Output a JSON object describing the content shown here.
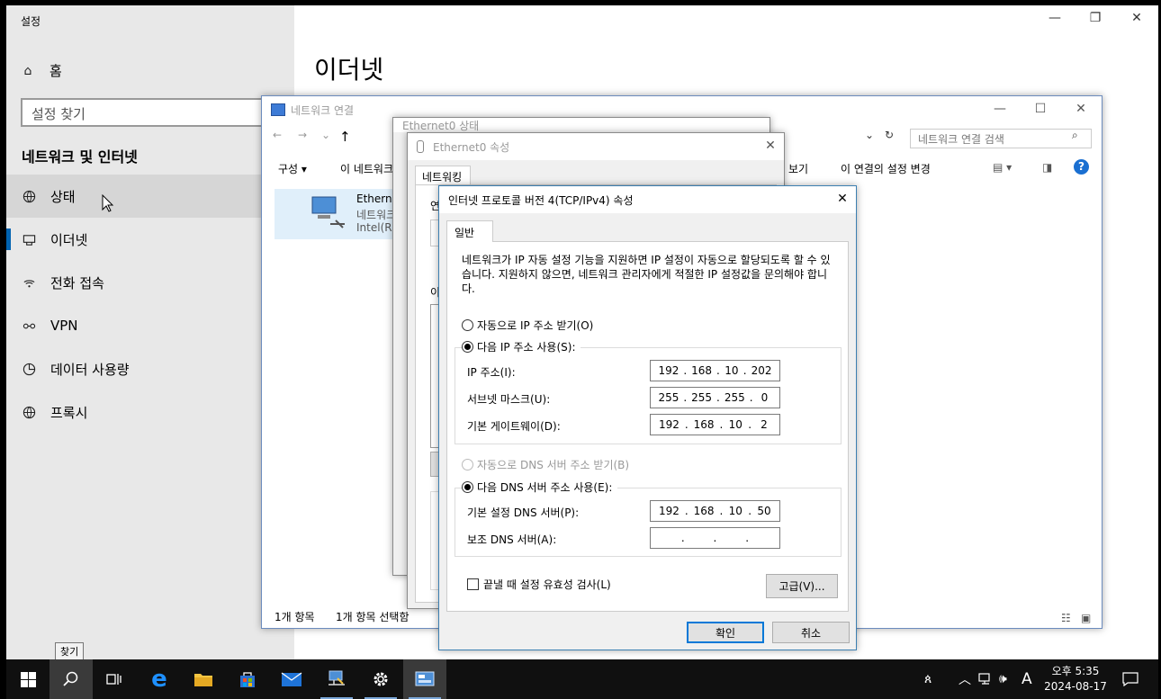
{
  "settings": {
    "window_title": "설정",
    "home_label": "홈",
    "search_placeholder": "설정 찾기",
    "section_title": "네트워크 및 인터넷",
    "nav_items": [
      {
        "label": "상태",
        "icon": "globe-icon"
      },
      {
        "label": "이더넷",
        "icon": "ethernet-icon"
      },
      {
        "label": "전화 접속",
        "icon": "dialup-icon"
      },
      {
        "label": "VPN",
        "icon": "vpn-icon"
      },
      {
        "label": "데이터 사용량",
        "icon": "data-usage-icon"
      },
      {
        "label": "프록시",
        "icon": "proxy-globe-icon"
      }
    ],
    "page_title": "이더넷"
  },
  "netconn": {
    "title": "네트워크 연결",
    "search_placeholder": "네트워크 연결 검색",
    "cmd_organize": "구성 ▾",
    "cmd_disable": "이 네트워크",
    "cmd_view": "보기",
    "cmd_rename": "이 연결의 설정 변경",
    "item_name": "Etherne",
    "item_sub1": "네트워크",
    "item_sub2": "Intel(R)",
    "status_count": "1개 항목",
    "status_selected": "1개 항목 선택함"
  },
  "ethstatus": {
    "title": "Ethernet0 상태"
  },
  "ethprops": {
    "title": "Ethernet0 속성",
    "tab": "네트워킹",
    "label_connect": "연",
    "label_items": "이"
  },
  "ipv4": {
    "title": "인터넷 프로토콜 버전 4(TCP/IPv4) 속성",
    "tab_general": "일반",
    "description": "네트워크가 IP 자동 설정 기능을 지원하면 IP 설정이 자동으로 할당되도록 할 수 있습니다. 지원하지 않으면, 네트워크 관리자에게 적절한 IP 설정값을 문의해야 합니다.",
    "radio_auto_ip": "자동으로 IP 주소 받기(O)",
    "radio_manual_ip": "다음 IP 주소 사용(S):",
    "label_ip": "IP 주소(I):",
    "ip": [
      "192",
      "168",
      "10",
      "202"
    ],
    "label_mask": "서브넷 마스크(U):",
    "mask": [
      "255",
      "255",
      "255",
      "0"
    ],
    "label_gateway": "기본 게이트웨이(D):",
    "gateway": [
      "192",
      "168",
      "10",
      "2"
    ],
    "radio_auto_dns": "자동으로 DNS 서버 주소 받기(B)",
    "radio_manual_dns": "다음 DNS 서버 주소 사용(E):",
    "label_dns1": "기본 설정 DNS 서버(P):",
    "dns1": [
      "192",
      "168",
      "10",
      "50"
    ],
    "label_dns2": "보조 DNS 서버(A):",
    "dns2": [
      "",
      "",
      "",
      ""
    ],
    "checkbox_validate": "끝낼 때 설정 유효성 검사(L)",
    "btn_advanced": "고급(V)...",
    "btn_ok": "확인",
    "btn_cancel": "취소"
  },
  "taskbar": {
    "tooltip": "찾기",
    "clock_time": "오후 5:35",
    "clock_date": "2024-08-17",
    "ime": "A"
  }
}
